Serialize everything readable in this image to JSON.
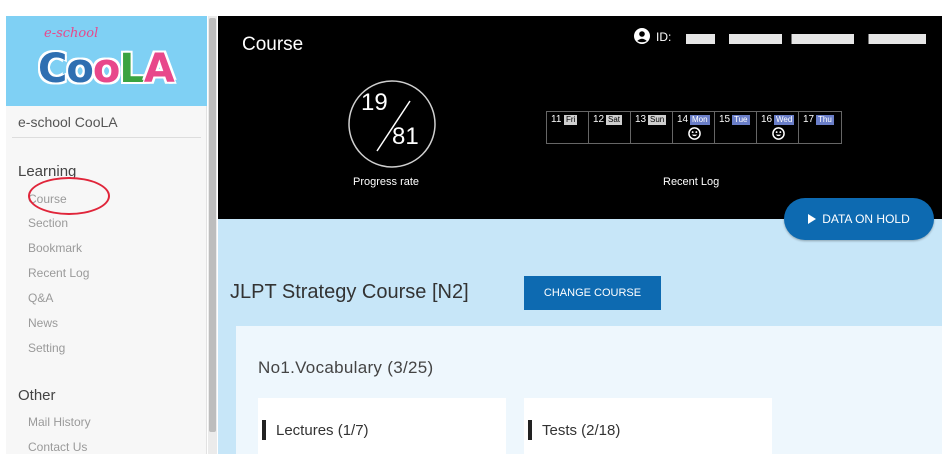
{
  "sidebar": {
    "logo_small": "e-school",
    "logo_main_parts": [
      "Co",
      "o",
      "L",
      "A"
    ],
    "brand_name": "e-school CooLA",
    "learning_title": "Learning",
    "learning_items": [
      "Course",
      "Section",
      "Bookmark",
      "Recent Log",
      "Q&A",
      "News",
      "Setting"
    ],
    "other_title": "Other",
    "other_items": [
      "Mail History",
      "Contact Us"
    ]
  },
  "header": {
    "title": "Course",
    "id_label": "ID:",
    "progress_done": "19",
    "progress_total": "81",
    "progress_label": "Progress rate",
    "recent_label": "Recent Log",
    "days": [
      {
        "num": "11",
        "wd": "Fri",
        "smile": false
      },
      {
        "num": "12",
        "wd": "Sat",
        "smile": false
      },
      {
        "num": "13",
        "wd": "Sun",
        "smile": false
      },
      {
        "num": "14",
        "wd": "Mon",
        "smile": true
      },
      {
        "num": "15",
        "wd": "Tue",
        "smile": false
      },
      {
        "num": "16",
        "wd": "Wed",
        "smile": true
      },
      {
        "num": "17",
        "wd": "Thu",
        "smile": false
      }
    ],
    "hold_button": "DATA ON HOLD"
  },
  "course": {
    "title": "JLPT Strategy Course [N2]",
    "change_button": "CHANGE COURSE",
    "unit_title": "No1.Vocabulary (3/25)",
    "lectures": "Lectures (1/7)",
    "tests": "Tests (2/18)"
  },
  "colors": {
    "accent": "#0d6ab1",
    "logo_bg": "#7fd0f4",
    "main_bg": "#c7e6f8",
    "highlight": "#e0253a"
  }
}
